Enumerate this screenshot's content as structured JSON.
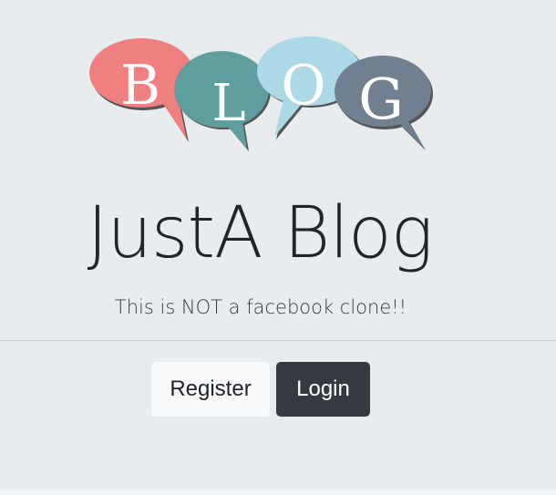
{
  "logo": {
    "letters": [
      "B",
      "L",
      "O",
      "G"
    ],
    "colors": {
      "b": "#f08080",
      "l": "#5f9e9e",
      "o": "#add8e6",
      "g": "#708090"
    }
  },
  "hero": {
    "title": "JustA Blog",
    "subtitle": "This is NOT a facebook clone!!"
  },
  "actions": {
    "register_label": "Register",
    "login_label": "Login"
  },
  "colors": {
    "background": "#e9ecef",
    "text": "#212529",
    "button_light": "#f8f9fa",
    "button_dark": "#343a40"
  }
}
